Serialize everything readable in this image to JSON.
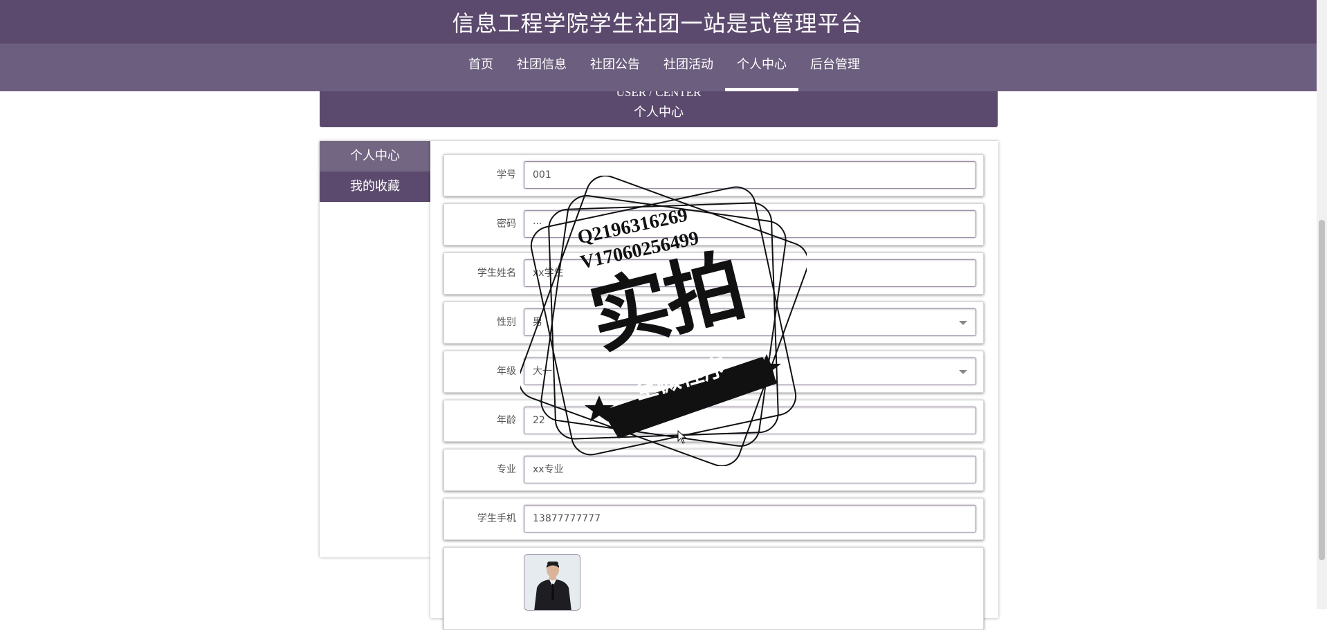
{
  "header": {
    "title": "信息工程学院学生社团一站是式管理平台"
  },
  "nav": {
    "items": [
      {
        "label": "首页"
      },
      {
        "label": "社团信息"
      },
      {
        "label": "社团公告"
      },
      {
        "label": "社团活动"
      },
      {
        "label": "个人中心",
        "active": true
      },
      {
        "label": "后台管理"
      }
    ]
  },
  "banner": {
    "title_en": "USER / CENTER",
    "title_cn": "个人中心"
  },
  "sidebar": {
    "items": [
      {
        "label": "个人中心",
        "active": true
      },
      {
        "label": "我的收藏"
      }
    ]
  },
  "form": {
    "student_id": {
      "label": "学号",
      "value": "001"
    },
    "password": {
      "label": "密码",
      "value": "···"
    },
    "student_name": {
      "label": "学生姓名",
      "value": "xx学生"
    },
    "gender": {
      "label": "性别",
      "value": "男"
    },
    "grade": {
      "label": "年级",
      "value": "大一"
    },
    "age": {
      "label": "年龄",
      "value": "22"
    },
    "major": {
      "label": "专业",
      "value": "xx专业"
    },
    "phone": {
      "label": "学生手机",
      "value": "13877777777"
    },
    "photo": {
      "label": ""
    }
  },
  "watermark": {
    "line1": "Q2196316269",
    "line2": "V17060256499",
    "main": "实拍",
    "ribbon": "全微程序"
  },
  "colors": {
    "primary": "#5c4a6e",
    "nav_bg": "#6c5e7e",
    "sidebar_active": "#726682"
  },
  "icons": {
    "select_arrow": "chevron-down-icon",
    "cursor": "mouse-pointer-icon",
    "photo": "user-photo"
  }
}
